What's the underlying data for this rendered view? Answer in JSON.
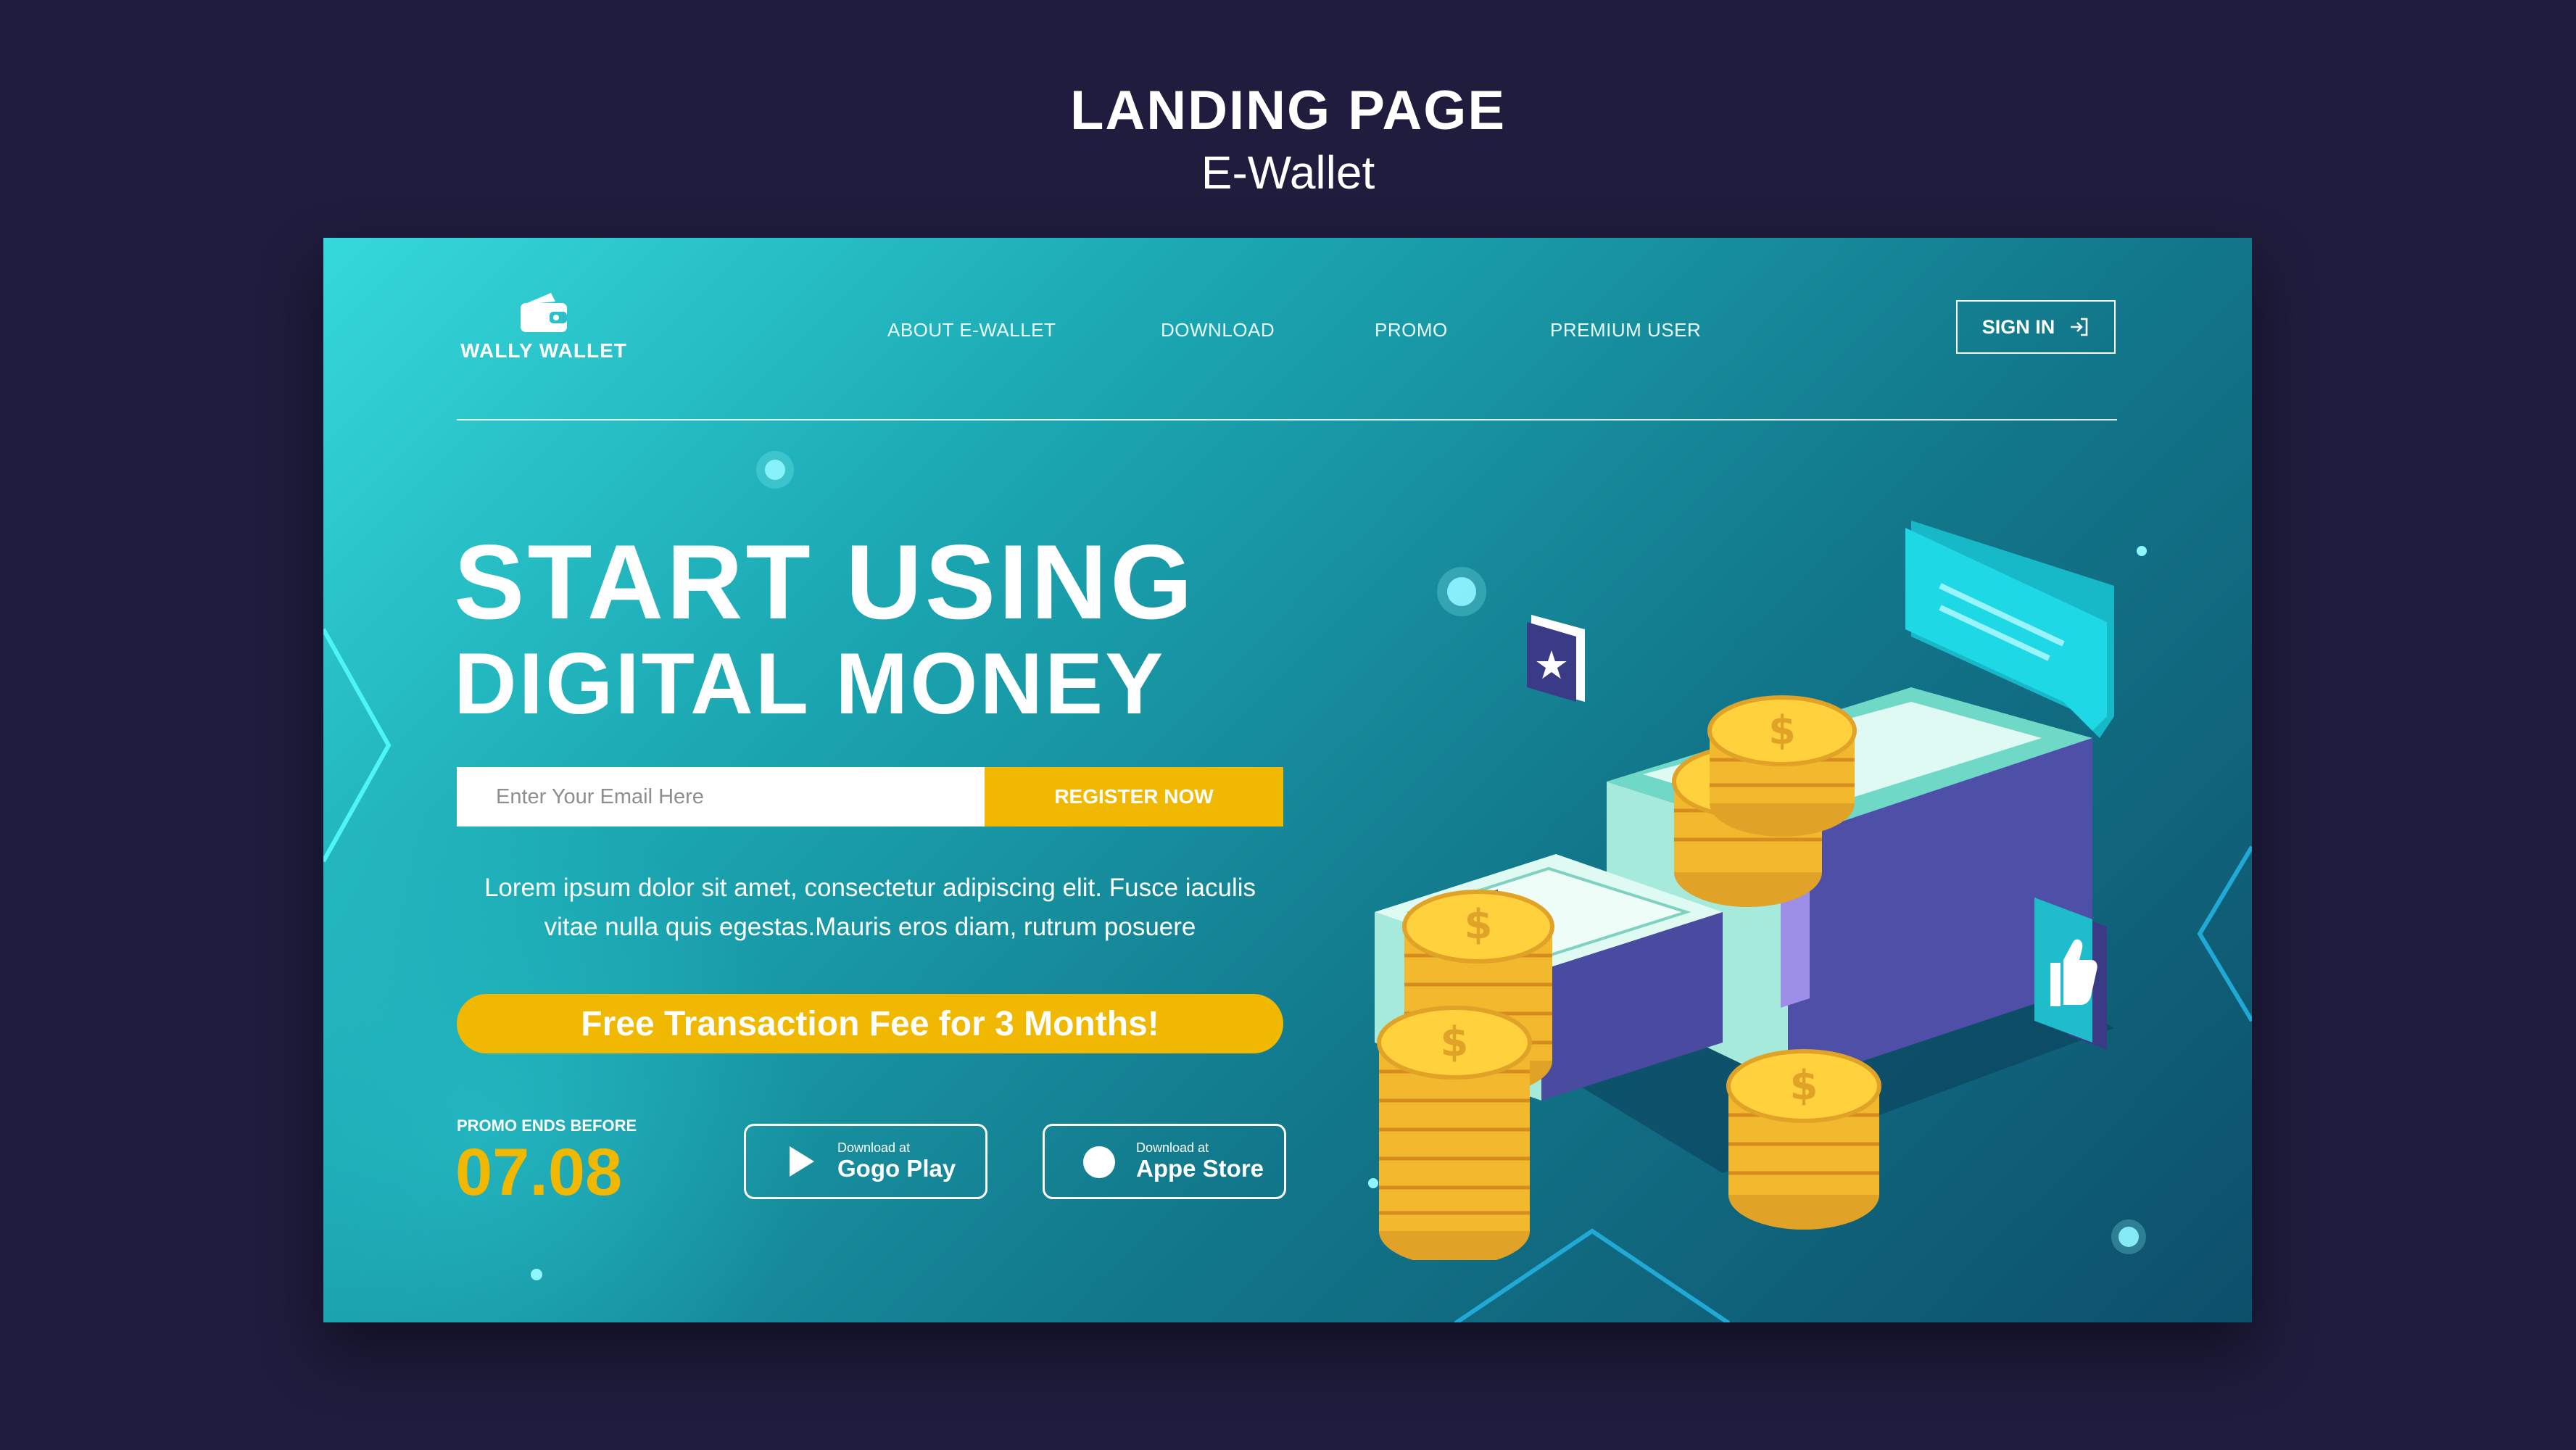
{
  "page": {
    "title": "LANDING PAGE",
    "subtitle": "E-Wallet"
  },
  "brand": {
    "name": "WALLY WALLET",
    "icon": "wallet-icon"
  },
  "nav": {
    "items": [
      {
        "label": "ABOUT E-WALLET"
      },
      {
        "label": "DOWNLOAD"
      },
      {
        "label": "PROMO"
      },
      {
        "label": "PREMIUM USER"
      }
    ],
    "sign_in": {
      "label": "SIGN IN",
      "icon": "sign-in-icon"
    }
  },
  "hero": {
    "title_line1": "START USING",
    "title_line2": "DIGITAL MONEY",
    "email_placeholder": "Enter Your Email Here",
    "register_label": "REGISTER NOW",
    "description": "Lorem ipsum dolor sit amet, consectetur adipiscing elit. Fusce iaculis vitae nulla quis egestas.Mauris eros diam, rutrum posuere",
    "promo_banner": "Free Transaction Fee for 3 Months!"
  },
  "promo": {
    "label": "PROMO ENDS BEFORE",
    "date": "07.08"
  },
  "stores": [
    {
      "small": "Download at",
      "big": "Gogo Play",
      "icon": "play-icon"
    },
    {
      "small": "Download at",
      "big": "Appe Store",
      "icon": "apple-icon"
    }
  ],
  "illustration": {
    "icons": [
      "money-stack-icon",
      "gold-coin-icon",
      "chat-bubble-icon",
      "star-badge-icon",
      "thumbs-up-icon"
    ]
  },
  "colors": {
    "page_bg": "#1f1c3d",
    "accent": "#f0b800",
    "teal_light": "#35d9db",
    "teal_dark": "#0d4f6a"
  }
}
